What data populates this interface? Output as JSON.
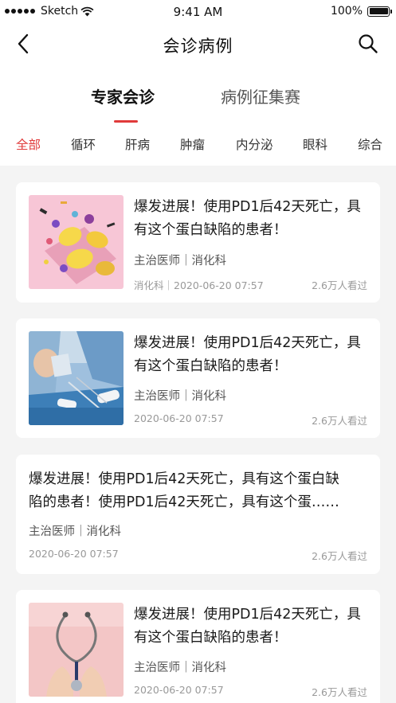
{
  "status_bar": {
    "carrier": "Sketch",
    "time": "9:41 AM",
    "battery": "100%"
  },
  "nav": {
    "title": "会诊病例",
    "back_icon": "chevron-left-icon",
    "search_icon": "search-icon"
  },
  "main_tabs": [
    {
      "label": "专家会诊",
      "active": true
    },
    {
      "label": "病例征集赛",
      "active": false
    }
  ],
  "categories": [
    "全部",
    "循环",
    "肝病",
    "肿瘤",
    "内分泌",
    "眼科",
    "综合"
  ],
  "accent_color": "#e03a3a",
  "cards": [
    {
      "title_line1": "爆发进展！使用PD1后42天死亡，具",
      "title_line2": "有这个蛋白缺陷的患者！",
      "author": "主治医师｜消化科",
      "meta": "消化科｜2020-06-20 07:57",
      "views": "2.6万人看过",
      "thumb": "pink-food-illustration"
    },
    {
      "title_line1": "爆发进展！使用PD1后42天死亡，具",
      "title_line2": "有这个蛋白缺陷的患者！",
      "author": "主治医师｜消化科",
      "meta": "2020-06-20 07:57",
      "views": "2.6万人看过",
      "thumb": "surgery-photo"
    },
    {
      "title_line1": "爆发进展！使用PD1后42天死亡，具有这个蛋白缺",
      "title_line2": "陷的患者！使用PD1后42天死亡，具有这个蛋……",
      "author": "主治医师｜消化科",
      "meta": "2020-06-20 07:57",
      "views": "2.6万人看过"
    },
    {
      "title_line1": "爆发进展！使用PD1后42天死亡，具",
      "title_line2": "有这个蛋白缺陷的患者！",
      "author": "主治医师｜消化科",
      "meta": "2020-06-20 07:57",
      "views": "2.6万人看过",
      "thumb": "stethoscope-photo"
    }
  ]
}
